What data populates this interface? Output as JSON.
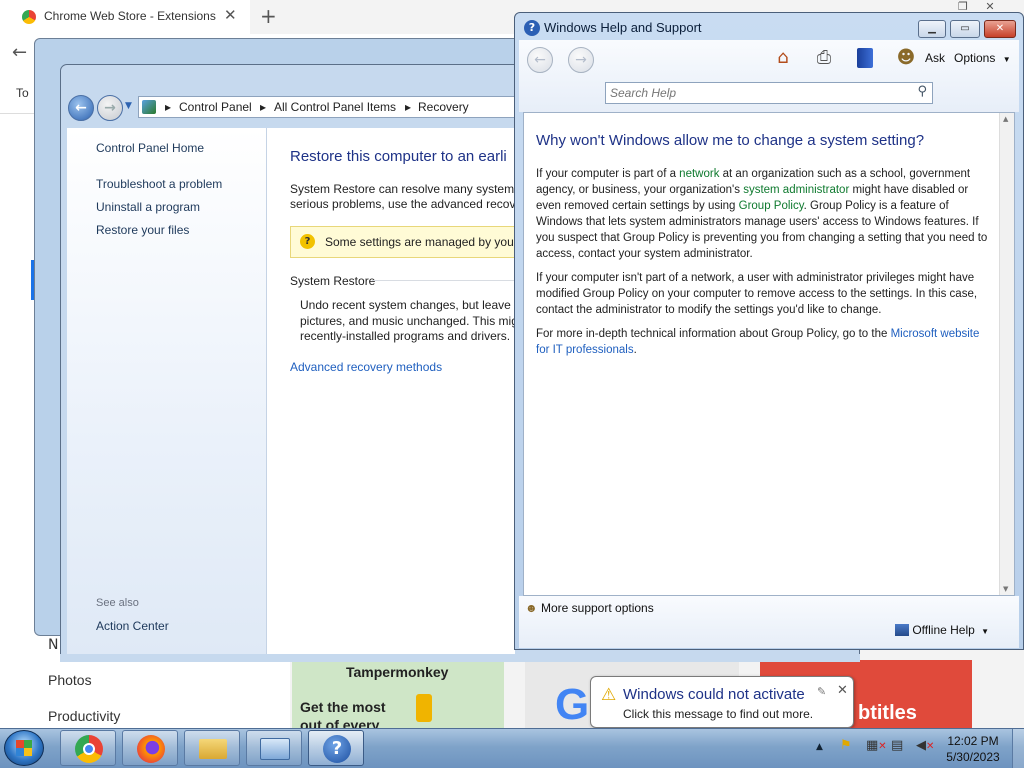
{
  "chrome": {
    "tab_title": "Chrome Web Store - Extensions",
    "to_text": "To",
    "sidebar": [
      "Photos",
      "Productivity"
    ],
    "sidebar_partial": "N",
    "cards": {
      "tampermonkey_title": "Tampermonkey",
      "tampermonkey_tagline": "Get the most out of every",
      "google_letter": "G",
      "subtitles_text": "btitles"
    }
  },
  "control_panel": {
    "breadcrumbs": [
      "Control Panel",
      "All Control Panel Items",
      "Recovery"
    ],
    "left_links": [
      "Control Panel Home",
      "Troubleshoot a problem",
      "Uninstall a program",
      "Restore your files"
    ],
    "see_also_label": "See also",
    "action_center": "Action Center",
    "title": "Restore this computer to an earli",
    "intro_line1": "System Restore can resolve many system p",
    "intro_line2": "serious problems, use the advanced recove",
    "warning": "Some settings are managed by your",
    "section_title": "System Restore",
    "restore_line1": "Undo recent system changes, but leave f",
    "restore_line2": "pictures, and music unchanged. This mig",
    "restore_line3": "recently-installed programs and drivers.",
    "advanced_link": "Advanced recovery methods"
  },
  "help": {
    "window_title": "Windows Help and Support",
    "ask_label": "Ask",
    "options_label": "Options",
    "search_placeholder": "Search Help",
    "heading": "Why won't Windows allow me to change a system setting?",
    "p1": {
      "a": "If your computer is part of a ",
      "link1": "network",
      "b": " at an organization such as a school, government agency, or business, your organization's ",
      "link2": "system administrator",
      "c": " might have disabled or even removed certain settings by using ",
      "link3": "Group Policy",
      "d": ". Group Policy is a feature of Windows that lets system administrators manage users' access to Windows features. If you suspect that Group Policy is preventing you from changing a setting that you need to access, contact your system administrator."
    },
    "p2": "If your computer isn't part of a network, a user with administrator privileges might have modified Group Policy on your computer to remove access to the settings. In this case, contact the administrator to modify the settings you'd like to change.",
    "p3": {
      "a": "For more in-depth technical information about Group Policy, go to the ",
      "link": "Microsoft website for IT professionals",
      "b": "."
    },
    "more_support": "More support options",
    "offline_help": "Offline Help"
  },
  "balloon": {
    "title": "Windows could not activate",
    "message": "Click this message to find out more."
  },
  "taskbar": {
    "time": "12:02 PM",
    "date": "5/30/2023"
  }
}
